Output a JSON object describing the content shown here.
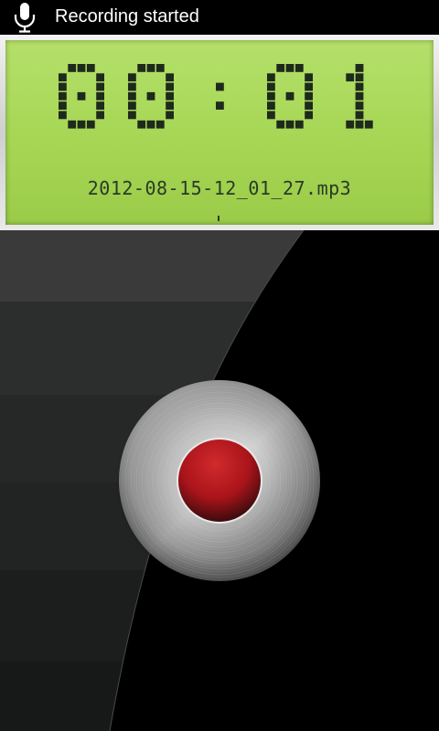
{
  "status_bar": {
    "icon": "microphone-icon",
    "message": "Recording started"
  },
  "lcd": {
    "timer": {
      "minutes": "00",
      "separator": ":",
      "seconds": "01"
    },
    "file_name": "2012-08-15-12_01_27.mp3",
    "colors": {
      "screen": "#a8d858",
      "pixel": "#1e2a1c"
    }
  },
  "recorder": {
    "button_icon": "record-icon",
    "record_color": "#b0161c"
  }
}
